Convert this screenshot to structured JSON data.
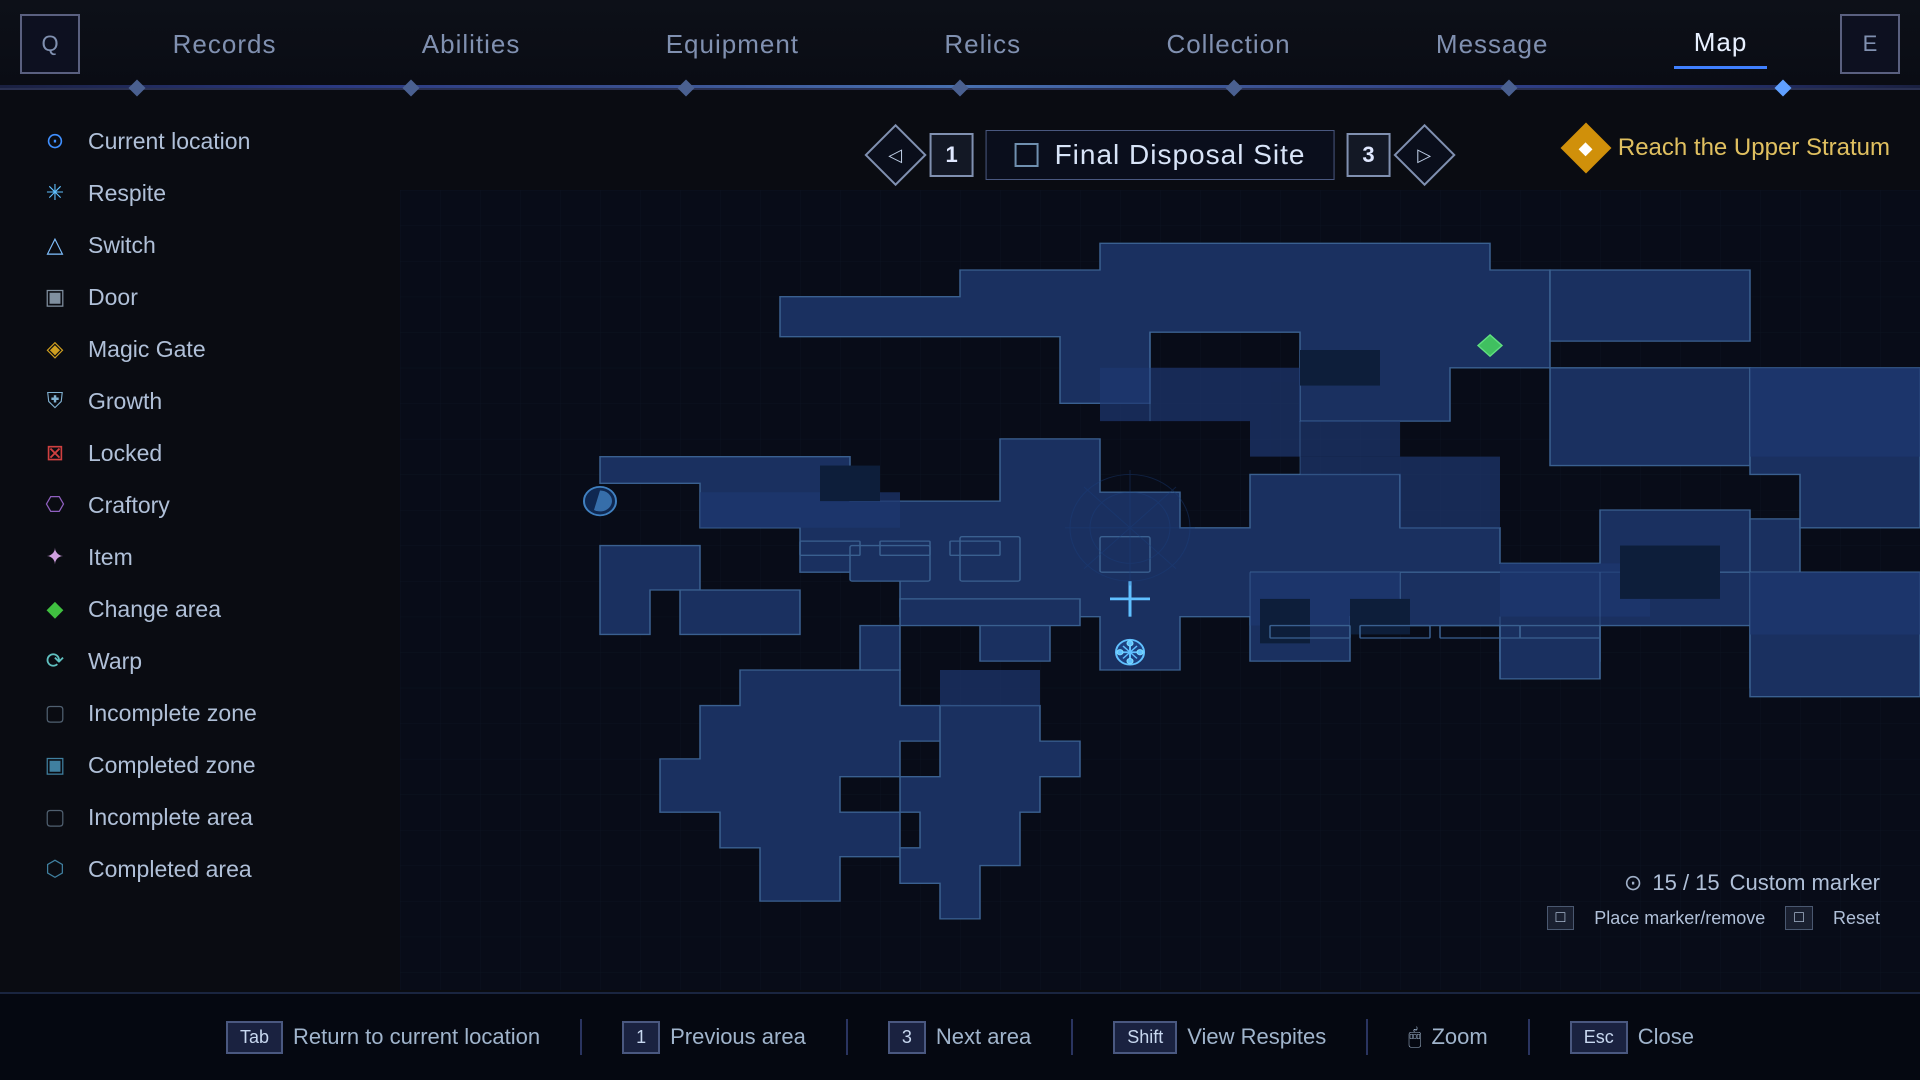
{
  "nav": {
    "left_icon": "Q",
    "right_icon": "E",
    "items": [
      {
        "label": "Records",
        "active": false
      },
      {
        "label": "Abilities",
        "active": false
      },
      {
        "label": "Equipment",
        "active": false
      },
      {
        "label": "Relics",
        "active": false
      },
      {
        "label": "Collection",
        "active": false
      },
      {
        "label": "Message",
        "active": false
      },
      {
        "label": "Map",
        "active": true
      }
    ]
  },
  "legend": {
    "items": [
      {
        "id": "current-location",
        "label": "Current location",
        "icon": "⊙",
        "css": "icon-current"
      },
      {
        "id": "respite",
        "label": "Respite",
        "icon": "✳",
        "css": "icon-respite"
      },
      {
        "id": "switch",
        "label": "Switch",
        "icon": "△",
        "css": "icon-switch"
      },
      {
        "id": "door",
        "label": "Door",
        "icon": "▣",
        "css": "icon-door"
      },
      {
        "id": "magic-gate",
        "label": "Magic Gate",
        "icon": "◈",
        "css": "icon-magic-gate"
      },
      {
        "id": "growth",
        "label": "Growth",
        "icon": "⛨",
        "css": "icon-growth"
      },
      {
        "id": "locked",
        "label": "Locked",
        "icon": "⊠",
        "css": "icon-locked"
      },
      {
        "id": "craftory",
        "label": "Craftory",
        "icon": "⎔",
        "css": "icon-craftory"
      },
      {
        "id": "item",
        "label": "Item",
        "icon": "✦",
        "css": "icon-item"
      },
      {
        "id": "change-area",
        "label": "Change area",
        "icon": "◆",
        "css": "icon-change"
      },
      {
        "id": "warp",
        "label": "Warp",
        "icon": "⟳",
        "css": "icon-warp"
      },
      {
        "id": "incomplete-zone",
        "label": "Incomplete zone",
        "icon": "▢",
        "css": "icon-incomplete-zone"
      },
      {
        "id": "completed-zone",
        "label": "Completed zone",
        "icon": "▣",
        "css": "icon-complete-zone"
      },
      {
        "id": "incomplete-area",
        "label": "Incomplete area",
        "icon": "▢",
        "css": "icon-incomplete-area"
      },
      {
        "id": "completed-area",
        "label": "Completed area",
        "icon": "⬡",
        "css": "icon-complete-area"
      }
    ]
  },
  "map": {
    "area_number_left": "1",
    "area_number_right": "3",
    "area_title": "Final Disposal Site",
    "objective_label": "Reach the Upper Stratum"
  },
  "marker_info": {
    "count": "15 / 15",
    "count_label": "Custom marker",
    "place_key": "□",
    "place_label": "Place marker/remove",
    "reset_key": "□",
    "reset_label": "Reset"
  },
  "bottom_bar": {
    "tab_key": "Tab",
    "tab_label": "Return to current location",
    "prev_key": "1",
    "prev_label": "Previous area",
    "next_key": "3",
    "next_label": "Next area",
    "shift_key": "Shift",
    "shift_label": "View Respites",
    "zoom_icon": "🖱",
    "zoom_label": "Zoom",
    "esc_key": "Esc",
    "esc_label": "Close"
  }
}
